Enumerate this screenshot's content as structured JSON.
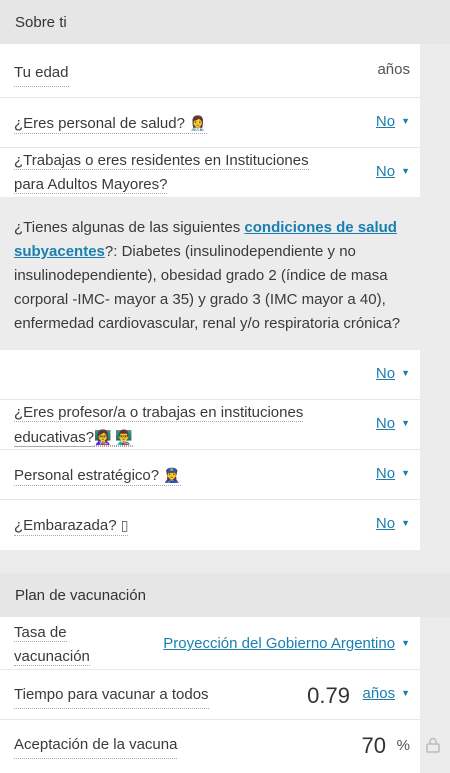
{
  "section1": {
    "title": "Sobre ti",
    "age_label": "Tu edad",
    "age_unit": "años",
    "health_label": "¿Eres personal de salud?",
    "health_icons": "👩‍⚕️",
    "health_value": "No",
    "residents_label_line1": "¿Trabajas o eres residentes en Instituciones",
    "residents_label_line2": "para Adultos Mayores?",
    "residents_value": "No",
    "conditions_pre": "¿Tienes algunas de las siguientes ",
    "conditions_link": "condiciones de salud subyacentes",
    "conditions_post": "?: Diabetes (insulinodependiente y no insulinodependiente), obesidad grado 2 (índice de masa corporal -IMC- mayor a 35) y grado 3 (IMC mayor a 40), enfermedad cardiovascular, renal y/o respiratoria crónica?",
    "conditions_value": "No",
    "teacher_label_line1": "¿Eres profesor/a o trabajas en instituciones",
    "teacher_label_line2": "educativas?",
    "teacher_icons": "👩‍🏫 👨‍🏫",
    "teacher_value": "No",
    "strategic_label": "Personal estratégico?",
    "strategic_icons": "👮‍♀️",
    "strategic_value": "No",
    "pregnant_label": "¿Embarazada?",
    "pregnant_icon": "▯",
    "pregnant_value": "No"
  },
  "section2": {
    "title": "Plan de vacunación",
    "rate_label_line1": "Tasa de",
    "rate_label_line2": "vacunación",
    "rate_value": "Proyección del Gobierno Argentino",
    "time_label": "Tiempo para vacunar a todos",
    "time_value": "0.79",
    "time_unit": "años",
    "acceptance_label": "Aceptación de la vacuna",
    "acceptance_value": "70",
    "acceptance_unit": "%"
  },
  "icons": {
    "caret": "▼",
    "lock": "lock-icon"
  },
  "colors": {
    "link": "#1a7fb0",
    "header_bg": "#e6e6e6",
    "panel_bg": "#ffffff"
  }
}
